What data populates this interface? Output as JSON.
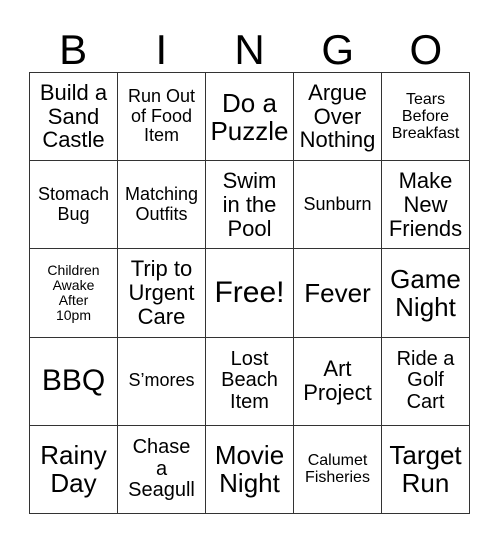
{
  "header": {
    "letters": [
      "B",
      "I",
      "N",
      "G",
      "O"
    ]
  },
  "cells": [
    "Build a\nSand\nCastle",
    "Run Out\nof Food\nItem",
    "Do a\nPuzzle",
    "Argue\nOver\nNothing",
    "Tears\nBefore\nBreakfast",
    "Stomach\nBug",
    "Matching\nOutfits",
    "Swim\nin the\nPool",
    "Sunburn",
    "Make\nNew\nFriends",
    "Children\nAwake\nAfter\n10pm",
    "Trip to\nUrgent\nCare",
    "Free!",
    "Fever",
    "Game\nNight",
    "BBQ",
    "S’mores",
    "Lost\nBeach\nItem",
    "Art\nProject",
    "Ride a\nGolf\nCart",
    "Rainy\nDay",
    "Chase\na\nSeagull",
    "Movie\nNight",
    "Calumet\nFisheries",
    "Target\nRun"
  ]
}
